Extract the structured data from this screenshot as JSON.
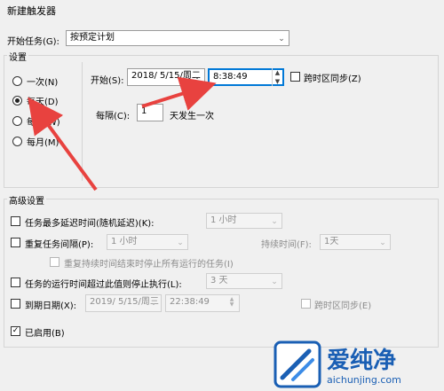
{
  "window": {
    "title": "新建触发器"
  },
  "begin": {
    "label": "开始任务(G):",
    "value": "按预定计划"
  },
  "settings": {
    "group_label": "设置",
    "radios": [
      {
        "label": "一次(N)",
        "checked": false
      },
      {
        "label": "每天(D)",
        "checked": true
      },
      {
        "label": "每周(W)",
        "checked": false
      },
      {
        "label": "每月(M)",
        "checked": false
      }
    ],
    "start_label": "开始(S):",
    "start_date": "2018/ 5/15/周二",
    "start_time": "8:38:49",
    "sync_label": "跨时区同步(Z)",
    "every_label": "每隔(C):",
    "every_value": "1",
    "every_suffix": "天发生一次"
  },
  "advanced": {
    "group_label": "高级设置",
    "delay": {
      "label": "任务最多延迟时间(随机延迟)(K):",
      "value": "1 小时"
    },
    "repeat": {
      "label": "重复任务间隔(P):",
      "value": "1 小时",
      "duration_label": "持续时间(F):",
      "duration_value": "1天"
    },
    "stop_all_label": "重复持续时间结束时停止所有运行的任务(I)",
    "stop_run": {
      "label": "任务的运行时间超过此值则停止执行(L):",
      "value": "3 天"
    },
    "expire": {
      "label": "到期日期(X):",
      "date": "2019/ 5/15/周三",
      "time": "22:38:49",
      "sync_label": "跨时区同步(E)"
    },
    "enabled_label": "已启用(B)"
  },
  "watermark": {
    "brand": "爱纯净",
    "url": "aichunjing.com"
  },
  "colors": {
    "annotation_arrow": "#e8423f",
    "highlight": "#0078d7",
    "logo_blue": "#1a5fb4"
  }
}
